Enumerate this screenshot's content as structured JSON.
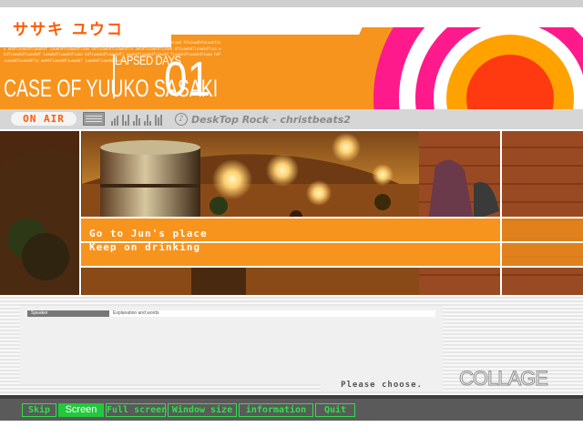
{
  "header": {
    "logo_text": "ササキ ユウコ",
    "tiny_text": "dasdahsdahsdfhjvasdfh aiwudfh aiuwhf aiuwhfaiuwhf aiudhfaiuwhf iudwhfaiuwdhfaiuwd hfaiuwdhfaiuwhfaiu whdfiauwhdfiauwhdf iauwhdfiuawhdfiuaw hdfiuawhdfiuawhdfiu awhdfiuawhdfiuawh dfiuawhdfiuawhdfiua whdfiuawhdfiuawhdf iuawhdfiuawhdfiuaw hdfiuawhdfiuawhdfi uawhdfiuawhdfiuawhd fiuawhdfiuawhdfiuaw hdfiuawhdfiuawhdfiu awhdfiuawhdfiuawhdf iuawhdfiuawhdfiuaw",
    "elapsed_label": "LAPSED DAYS",
    "day_number": "01",
    "case_title": "CASE OF YUUKO SASAKI",
    "colors": {
      "orange": "#f7941d",
      "ring_magenta": "#ff1a8c",
      "ring_orange": "#ffa200",
      "ring_red": "#ff3a10"
    }
  },
  "radio": {
    "status": "ON AIR",
    "track": "DeskTop Rock - christbeats2",
    "icons": [
      "radio-icon",
      "equalizer-icon",
      "music-note-icon"
    ]
  },
  "scene": {
    "choices": [
      "Go to Jun's place",
      "Keep on drinking"
    ]
  },
  "message": {
    "speaker_label": "Speaker",
    "words_label": "Explanation and words",
    "text": ""
  },
  "prompt": "Please choose.",
  "brand": "COLLAGE",
  "menu": {
    "buttons": [
      "Skip",
      "Screen",
      "Full screen",
      "Window size",
      "information",
      "Quit"
    ],
    "active_index": 1,
    "colors": {
      "green": "#2ee04a",
      "active_bg": "#22c93c"
    }
  }
}
